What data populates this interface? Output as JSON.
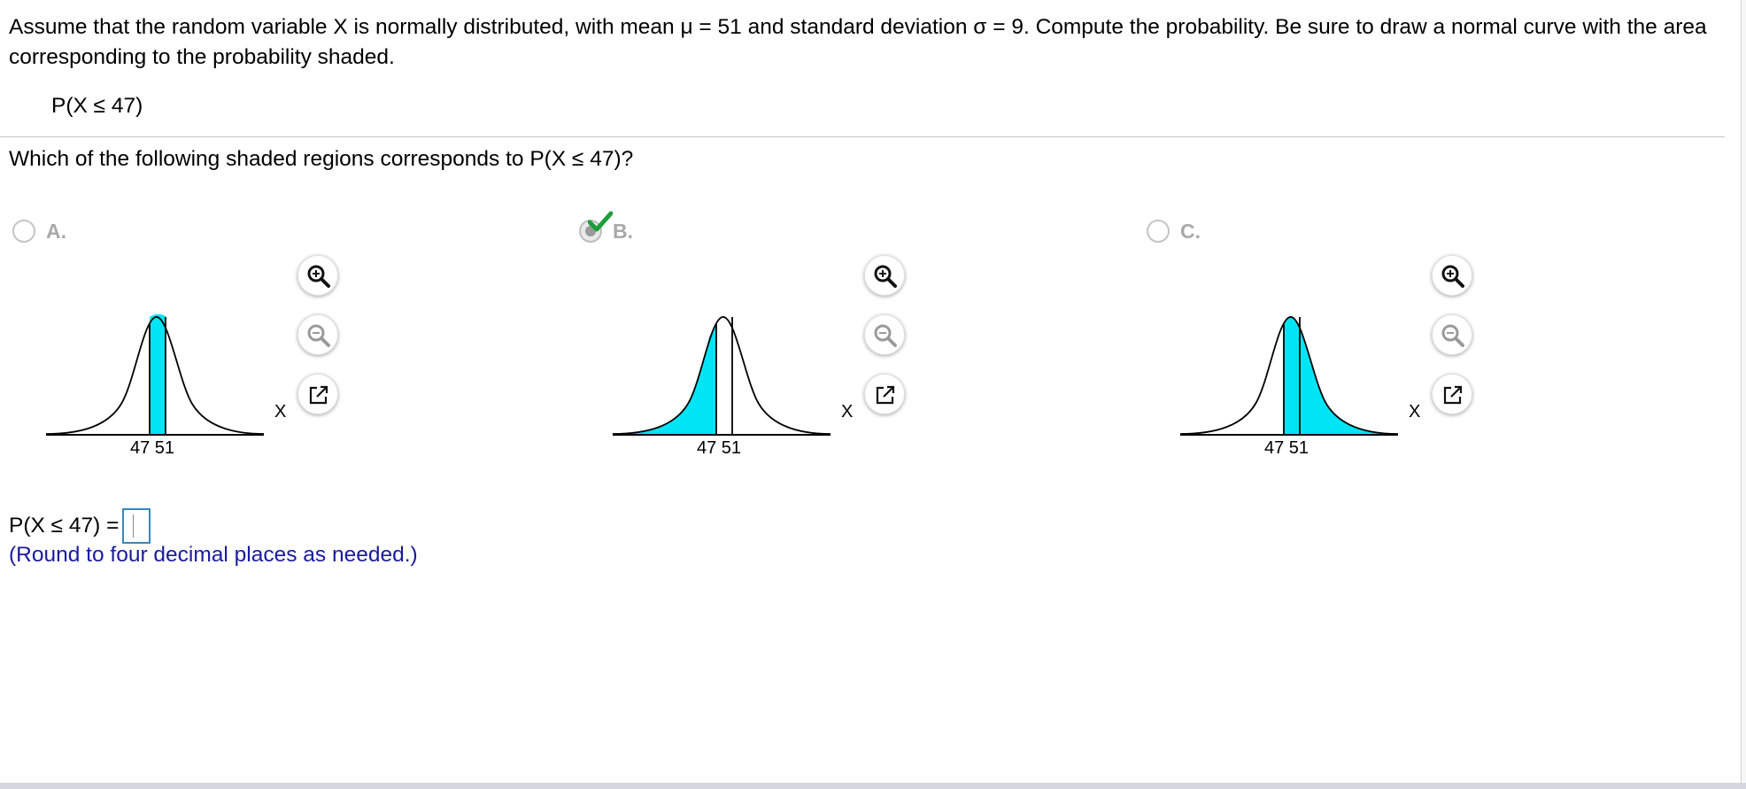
{
  "problem": {
    "text": "Assume that the random variable X is normally distributed, with mean μ = 51 and standard deviation σ = 9. Compute the probability. Be sure to draw a normal curve with the area corresponding to the probability shaded.",
    "expression": "P(X ≤ 47)"
  },
  "question": {
    "text": "Which of the following shaded regions corresponds to P(X ≤ 47)?"
  },
  "options": [
    {
      "letter": "A.",
      "selected": false,
      "shading": "between 47 and 51",
      "tick_labels": "47 51",
      "axis_label": "X"
    },
    {
      "letter": "B.",
      "selected": true,
      "shading": "left of 47",
      "tick_labels": "47 51",
      "axis_label": "X"
    },
    {
      "letter": "C.",
      "selected": false,
      "shading": "right of 47",
      "tick_labels": "47 51",
      "axis_label": "X"
    }
  ],
  "answer": {
    "label": "P(X ≤ 47) =",
    "value": "",
    "note": "(Round to four decimal places as needed.)"
  },
  "tools": {
    "zoom_in": "zoom-in-icon",
    "zoom_out": "zoom-out-icon",
    "popout": "popout-icon"
  },
  "colors": {
    "shade": "#00e5f5",
    "check": "#1e9e3a",
    "note_text": "#1a1aa0",
    "answer_border": "#3a86b7"
  }
}
